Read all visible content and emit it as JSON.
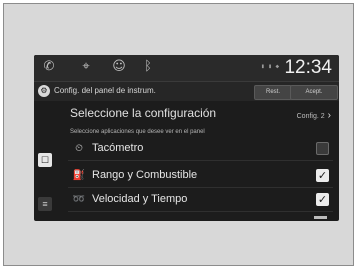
{
  "status_bar": {
    "icons": [
      "phone-icon",
      "navigation-icon",
      "user-icon",
      "bluetooth-icon"
    ],
    "signal_text": "▮ ▮ ◆",
    "time": "12:34"
  },
  "header": {
    "title": "Config. del panel de instrum.",
    "reset_label": "Rest.",
    "ok_label": "Acept."
  },
  "section": {
    "title": "Seleccione la configuración",
    "link_label": "Config. 2"
  },
  "subtitle": "Seleccione aplicaciones que desee ver en el panel",
  "sidebar": {
    "button_1": "☐",
    "button_2": "≡"
  },
  "items": [
    {
      "label": "Tacómetro",
      "icon": "tachometer-icon",
      "checked": false
    },
    {
      "label": "Rango y Combustible",
      "icon": "fuel-icon",
      "checked": true
    },
    {
      "label": "Velocidad y Tiempo",
      "icon": "speed-time-icon",
      "checked": true
    }
  ],
  "colors": {
    "screen_bg": "#1c1c1c",
    "text": "#e6e6e6",
    "check_on": "#ececec"
  }
}
